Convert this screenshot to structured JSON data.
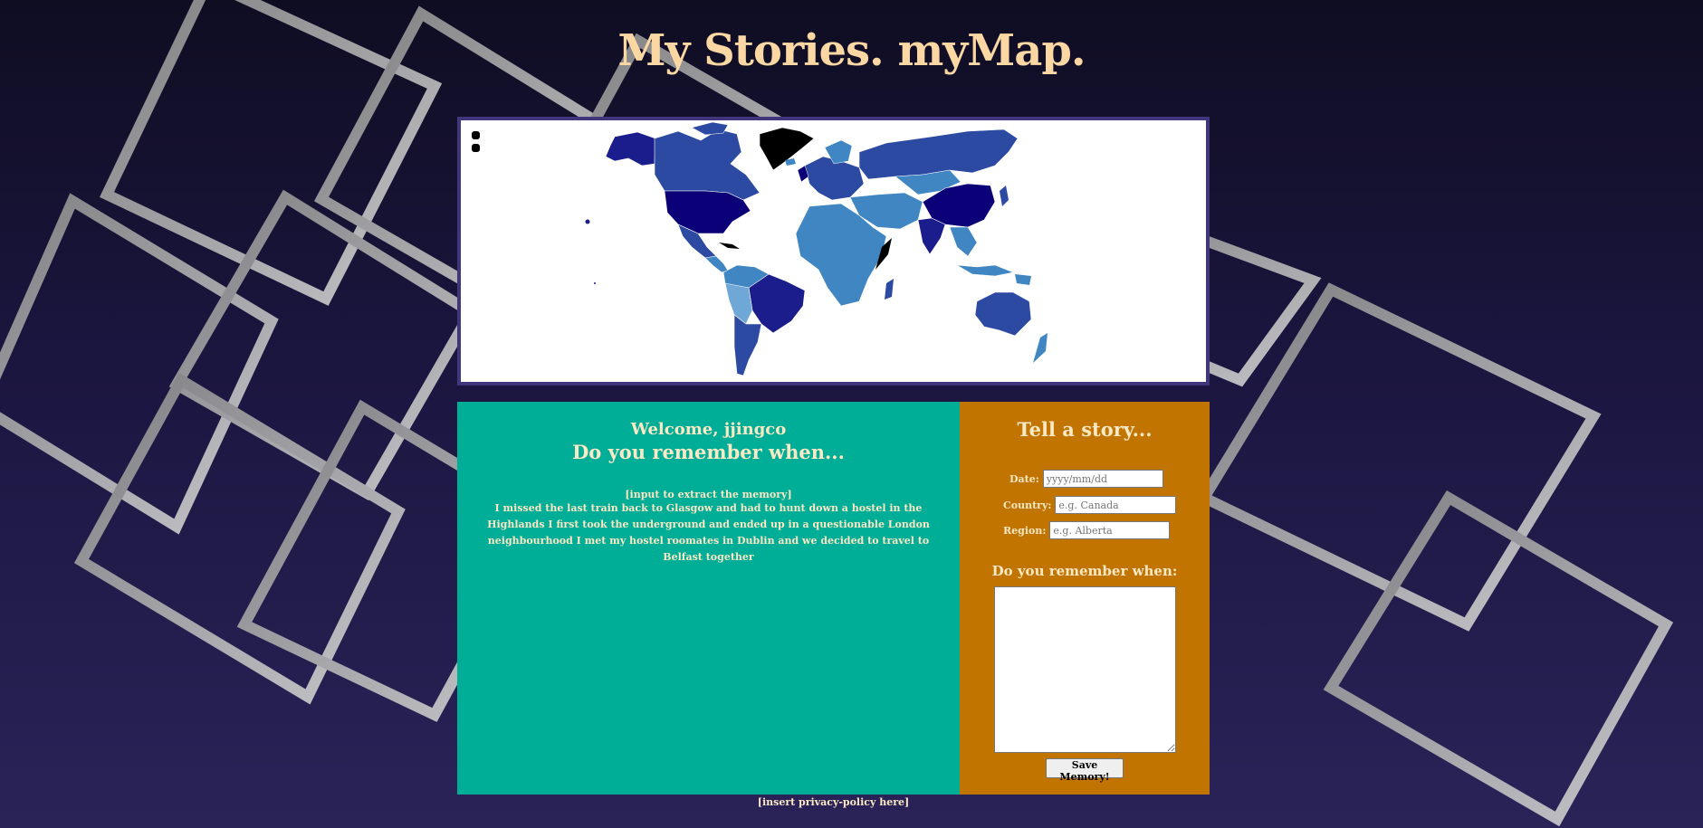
{
  "page": {
    "title": "My Stories. myMap."
  },
  "map": {
    "zoom_in_icon": "zoom-in-icon",
    "zoom_out_icon": "zoom-out-icon",
    "colors": {
      "lightest": "#6fa7d6",
      "light": "#3f86c2",
      "medium": "#2d4aa3",
      "dark": "#1b1d8c",
      "darkest": "#0c0078",
      "black": "#000000"
    }
  },
  "story": {
    "welcome": "Welcome, jjingco",
    "heading": "Do you remember when...",
    "hint": "[input to extract the memory]",
    "memories": "I missed the last train back to Glasgow and had to hunt down a hostel in the Highlands I first took the underground and ended up in a questionable London neighbourhood I met my hostel roomates in Dublin and we decided to travel to Belfast together"
  },
  "form": {
    "title": "Tell a story...",
    "date_label": "Date:",
    "date_placeholder": "yyyy/mm/dd",
    "country_label": "Country:",
    "country_placeholder": "e.g. Canada",
    "region_label": "Region:",
    "region_placeholder": "e.g. Alberta",
    "remember_label": "Do you remember when:",
    "save_label": "Save Memory!"
  },
  "footer": {
    "privacy": "[insert privacy-policy here]"
  },
  "colors": {
    "title": "#fbd7a4",
    "story_panel": "#00ad96",
    "form_panel": "#c17400",
    "map_border": "#41357c"
  }
}
